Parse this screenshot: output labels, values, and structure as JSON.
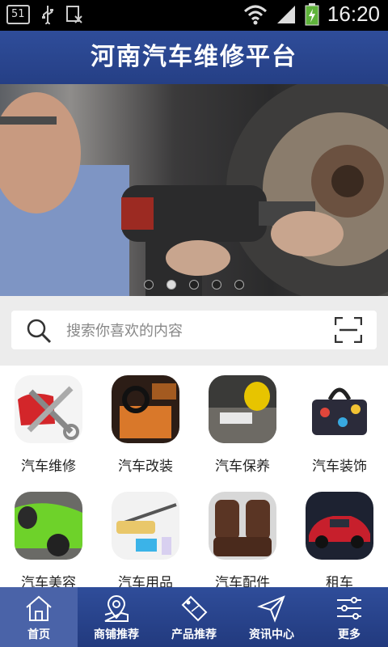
{
  "status_bar": {
    "notification_count": "51",
    "time": "16:20"
  },
  "header": {
    "title": "河南汽车维修平台"
  },
  "banner": {
    "slide_count": 5,
    "active_slide": 2
  },
  "search": {
    "placeholder": "搜索你喜欢的内容"
  },
  "categories": [
    {
      "label": "汽车维修",
      "icon": "repair-tools-icon"
    },
    {
      "label": "汽车改装",
      "icon": "car-interior-icon"
    },
    {
      "label": "汽车保养",
      "icon": "engine-service-icon"
    },
    {
      "label": "汽车装饰",
      "icon": "decor-bag-icon"
    },
    {
      "label": "汽车美容",
      "icon": "car-wash-icon"
    },
    {
      "label": "汽车用品",
      "icon": "duster-icon"
    },
    {
      "label": "汽车配件",
      "icon": "seat-cover-icon"
    },
    {
      "label": "租车",
      "icon": "rental-car-icon"
    }
  ],
  "tabs": [
    {
      "label": "首页",
      "icon": "home-icon"
    },
    {
      "label": "商铺推荐",
      "icon": "map-pin-icon"
    },
    {
      "label": "产品推荐",
      "icon": "sale-tag-icon"
    },
    {
      "label": "资讯中心",
      "icon": "send-icon"
    },
    {
      "label": "更多",
      "icon": "sliders-icon"
    }
  ],
  "colors": {
    "brand_blue": "#2b4690",
    "tab_active": "#4a63a8"
  }
}
